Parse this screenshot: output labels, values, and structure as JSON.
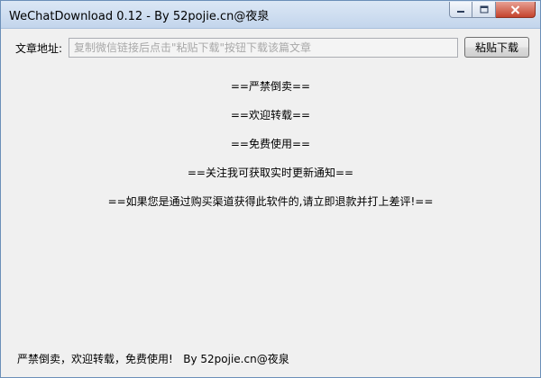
{
  "window": {
    "title": "WeChatDownload 0.12 - By 52pojie.cn@夜泉",
    "controls": {
      "minimize": "minimize-icon",
      "maximize": "maximize-icon",
      "close": "close-icon"
    }
  },
  "form": {
    "address_label": "文章地址:",
    "url_value": "",
    "url_placeholder": "复制微信链接后点击\"粘贴下载\"按钮下载该篇文章",
    "paste_button": "粘贴下载"
  },
  "notices": [
    "==严禁倒卖==",
    "==欢迎转载==",
    "==免费使用==",
    "==关注我可获取实时更新通知==",
    "==如果您是通过购买渠道获得此软件的,请立即退款并打上差评!=="
  ],
  "footer": "严禁倒卖，欢迎转载，免费使用!   By 52pojie.cn@夜泉"
}
